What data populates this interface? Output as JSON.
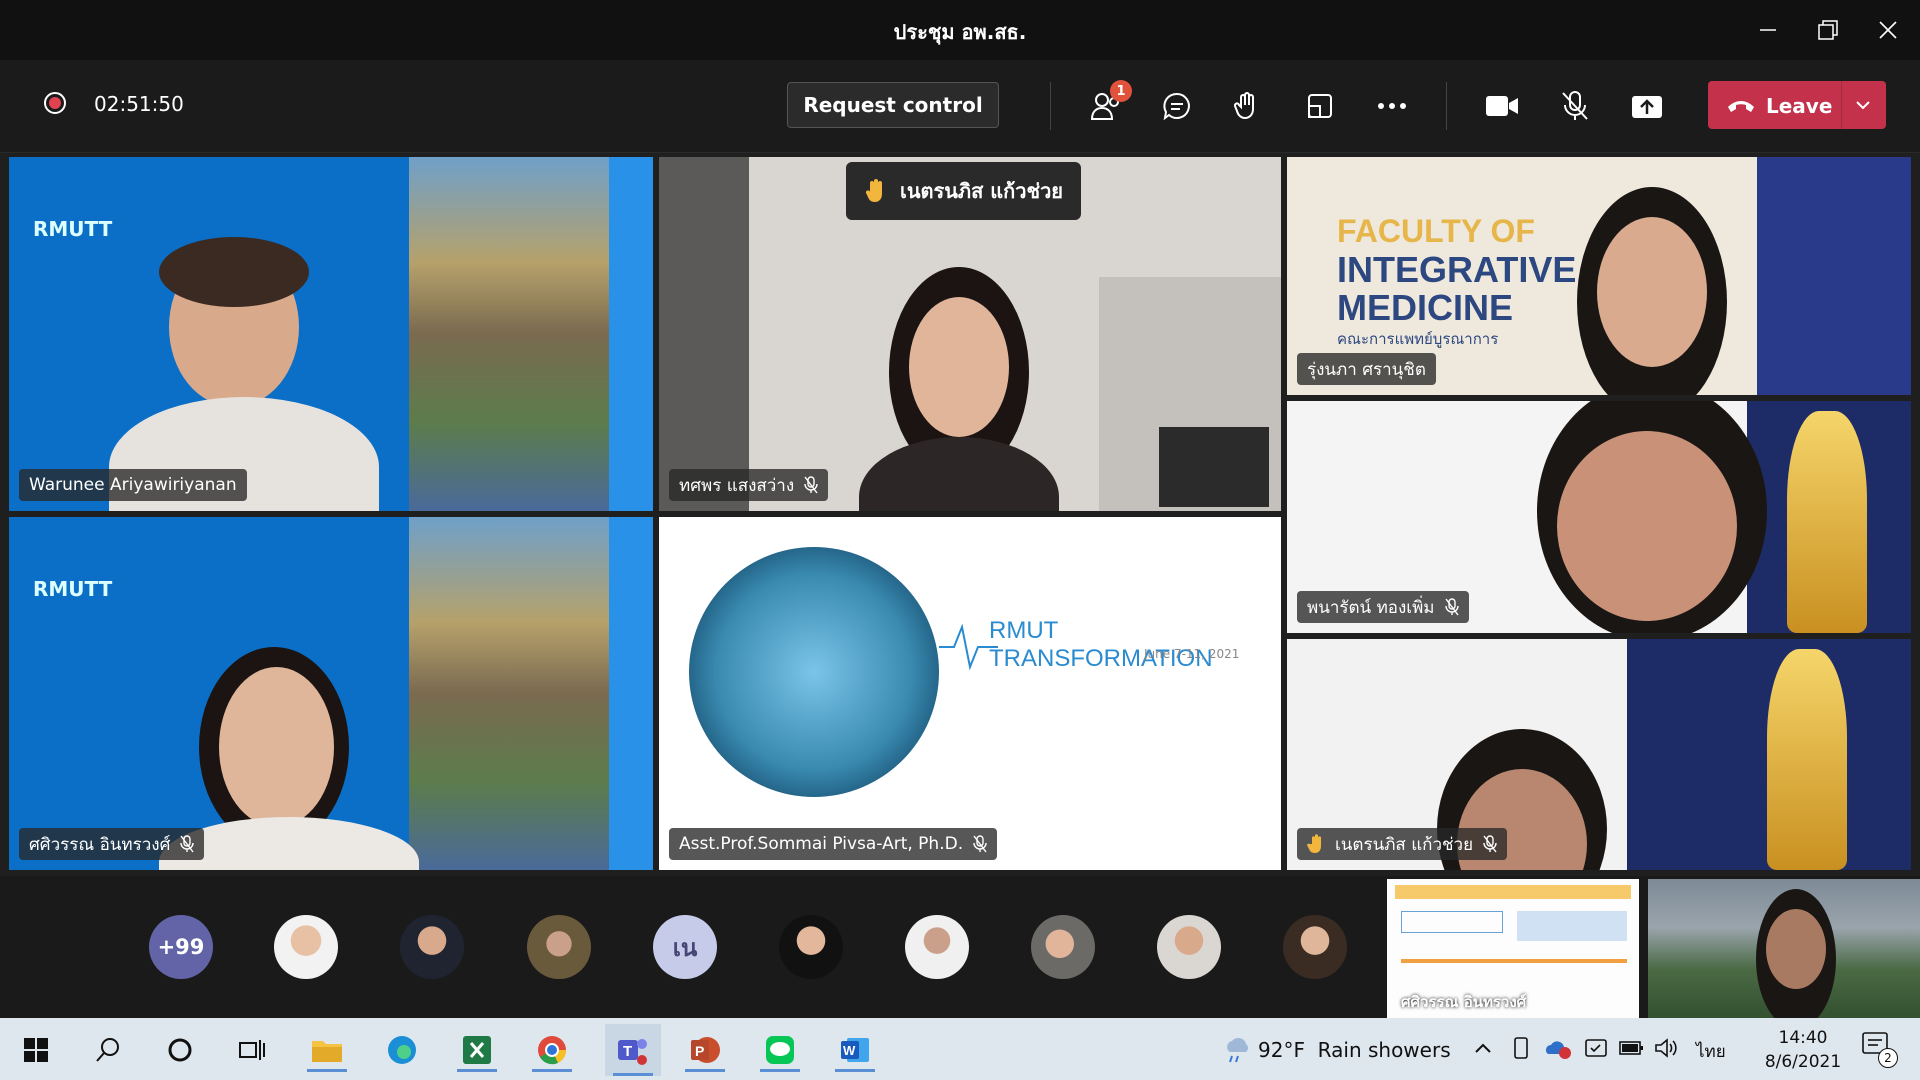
{
  "window": {
    "title": "ประชุม อพ.สธ."
  },
  "toolbar": {
    "timer": "02:51:50",
    "request_control": "Request control",
    "participants_badge": "1",
    "leave_label": "Leave"
  },
  "raised_hand_banner": "เนตรนภิส แก้วช่วย",
  "tiles": [
    {
      "name": "Warunee Ariyawiriyanan"
    },
    {
      "name": "ทศพร แสงสว่าง"
    },
    {
      "name": "รุ่งนภา ศรานุชิต"
    },
    {
      "name": "ศศิวรรณ อินทรวงศ์"
    },
    {
      "name": "Asst.Prof.Sommai Pivsa-Art, Ph.D."
    },
    {
      "name": "พนารัตน์ ทองเพิ่ม"
    },
    {
      "name": "เนตรนภิส แก้วช่วย"
    }
  ],
  "slides": {
    "faculty_line1": "FACULTY OF",
    "faculty_line2": "INTEGRATIVE",
    "faculty_line3": "MEDICINE",
    "faculty_thai": "คณะการแพทย์บูรณาการ",
    "rmut": "RMUT TRANSFORMATION",
    "rmut_date": "June 7-11, 2021",
    "rmutt": "RMUTT"
  },
  "strip": {
    "more_count": "+99",
    "initials": "เน",
    "share_caption": "ศศิวรรณ อินทรวงศ์"
  },
  "taskbar": {
    "weather_temp": "92°F",
    "weather_desc": "Rain showers",
    "lang": "ไทย",
    "time": "14:40",
    "date": "8/6/2021",
    "notif_count": "2"
  },
  "colors": {
    "leave": "#c4314b",
    "accent": "#6264a7",
    "rec": "#e0434f"
  }
}
